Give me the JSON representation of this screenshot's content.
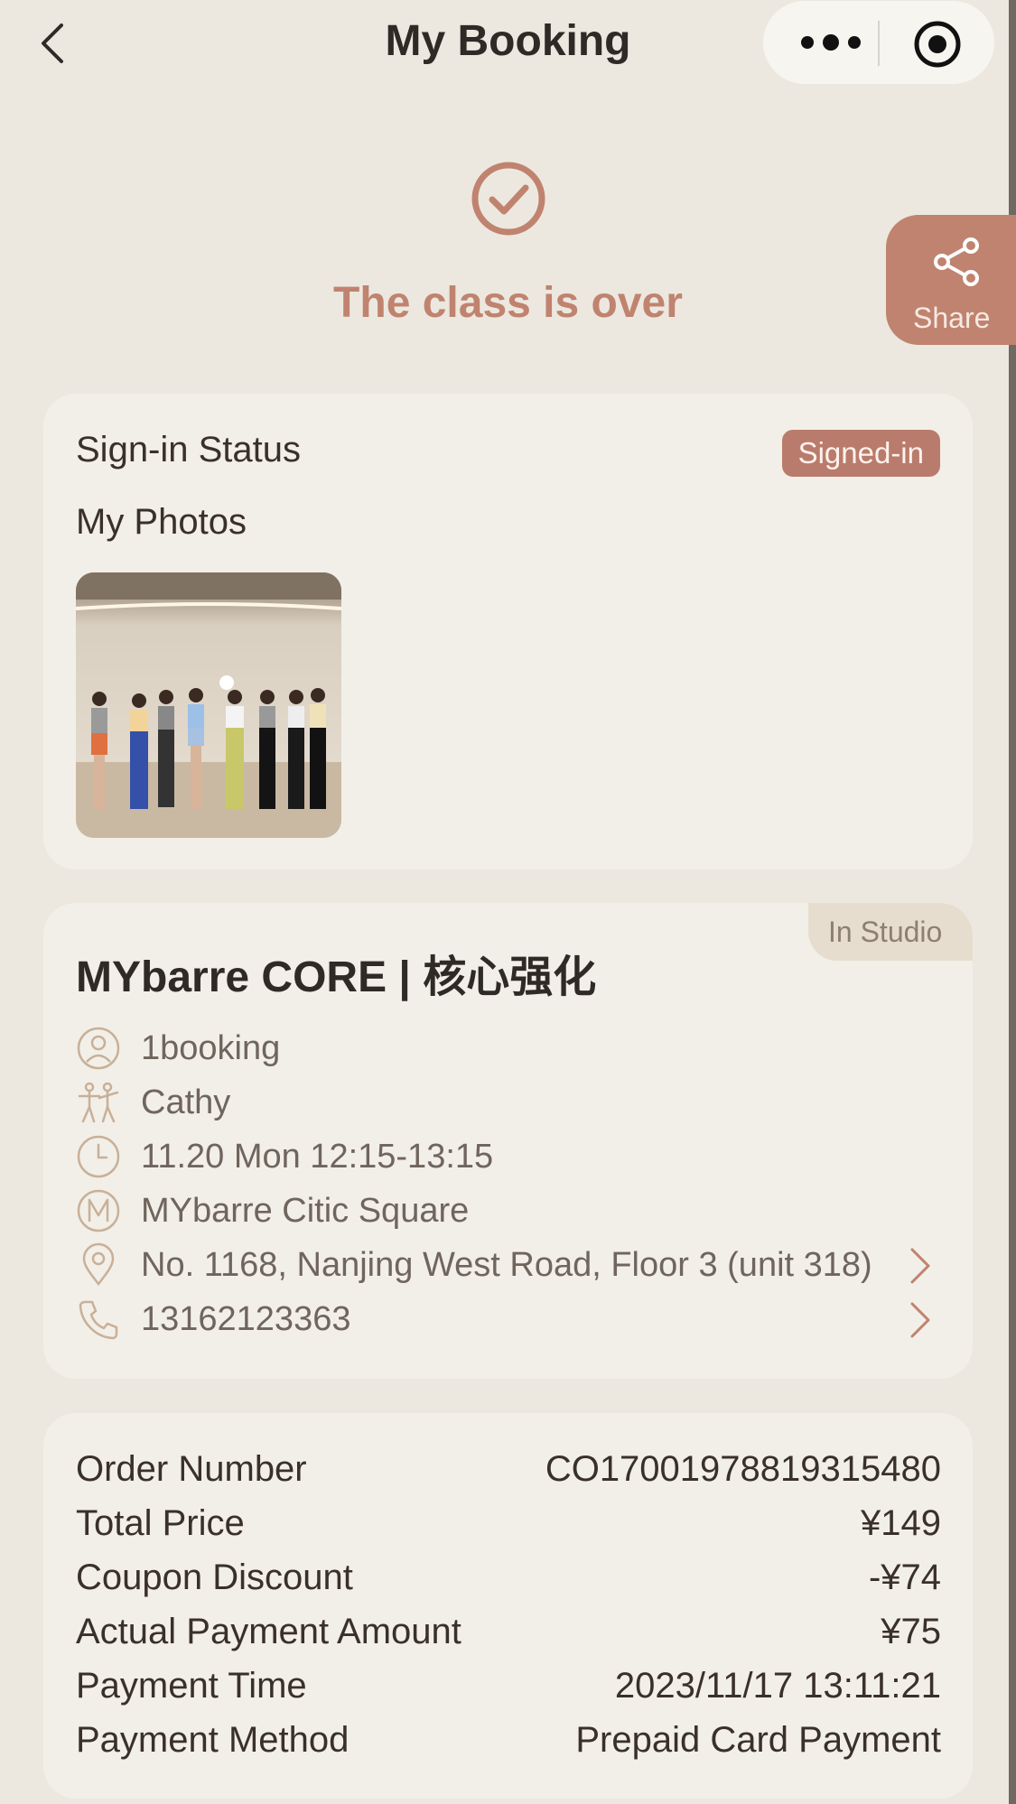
{
  "header": {
    "title": "My Booking"
  },
  "status": {
    "text": "The class is over"
  },
  "share": {
    "label": "Share"
  },
  "signin": {
    "label": "Sign-in Status",
    "badge": "Signed-in",
    "photos_label": "My Photos",
    "photos": [
      {
        "alt": "group photo"
      }
    ]
  },
  "class_info": {
    "tag": "In Studio",
    "title": "MYbarre CORE | 核心强化",
    "rows": [
      {
        "icon": "user-icon",
        "text": "1booking"
      },
      {
        "icon": "instructor-icon",
        "text": "Cathy"
      },
      {
        "icon": "clock-icon",
        "text": "11.20 Mon 12:15-13:15"
      },
      {
        "icon": "studio-logo-icon",
        "text": "MYbarre Citic Square"
      },
      {
        "icon": "location-pin-icon",
        "text": "No. 1168, Nanjing West Road, Floor 3 (unit 318)"
      },
      {
        "icon": "phone-icon",
        "text": "13162123363"
      }
    ]
  },
  "order": {
    "rows": [
      {
        "label": "Order Number",
        "value": "CO17001978819315480"
      },
      {
        "label": "Total Price",
        "value": "¥149"
      },
      {
        "label": "Coupon Discount",
        "value": "-¥74"
      },
      {
        "label": "Actual Payment Amount",
        "value": "¥75"
      },
      {
        "label": "Payment Time",
        "value": "2023/11/17 13:11:21"
      },
      {
        "label": "Payment Method",
        "value": "Prepaid Card Payment"
      }
    ]
  },
  "colors": {
    "background": "#ece8df",
    "card": "#f2efe8",
    "accent": "#c0836f",
    "badge": "#b97c6c",
    "text": "#3a302a",
    "muted": "#6f655d",
    "icon": "#c8b098"
  }
}
